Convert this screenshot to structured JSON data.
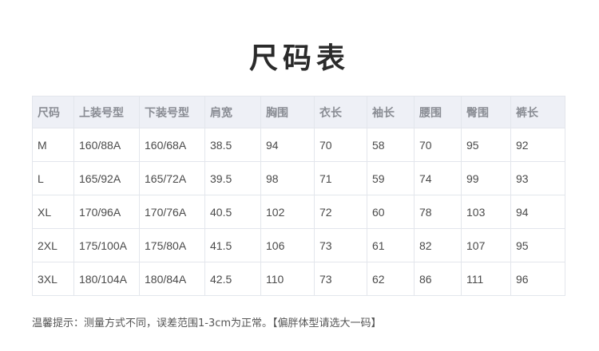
{
  "title": "尺码表",
  "table": {
    "headers": [
      "尺码",
      "上装号型",
      "下装号型",
      "肩宽",
      "胸围",
      "衣长",
      "袖长",
      "腰围",
      "臀围",
      "裤长"
    ],
    "rows": [
      [
        "M",
        "160/88A",
        "160/68A",
        "38.5",
        "94",
        "70",
        "58",
        "70",
        "95",
        "92"
      ],
      [
        "L",
        "165/92A",
        "165/72A",
        "39.5",
        "98",
        "71",
        "59",
        "74",
        "99",
        "93"
      ],
      [
        "XL",
        "170/96A",
        "170/76A",
        "40.5",
        "102",
        "72",
        "60",
        "78",
        "103",
        "94"
      ],
      [
        "2XL",
        "175/100A",
        "175/80A",
        "41.5",
        "106",
        "73",
        "61",
        "82",
        "107",
        "95"
      ],
      [
        "3XL",
        "180/104A",
        "180/84A",
        "42.5",
        "110",
        "73",
        "62",
        "86",
        "111",
        "96"
      ]
    ]
  },
  "note": "温馨提示：测量方式不同，误差范围1-3cm为正常。【偏胖体型请选大一码】",
  "colors": {
    "header_bg": "#eef0f6",
    "border": "#e3e6ec",
    "title": "#2a2a2a"
  }
}
